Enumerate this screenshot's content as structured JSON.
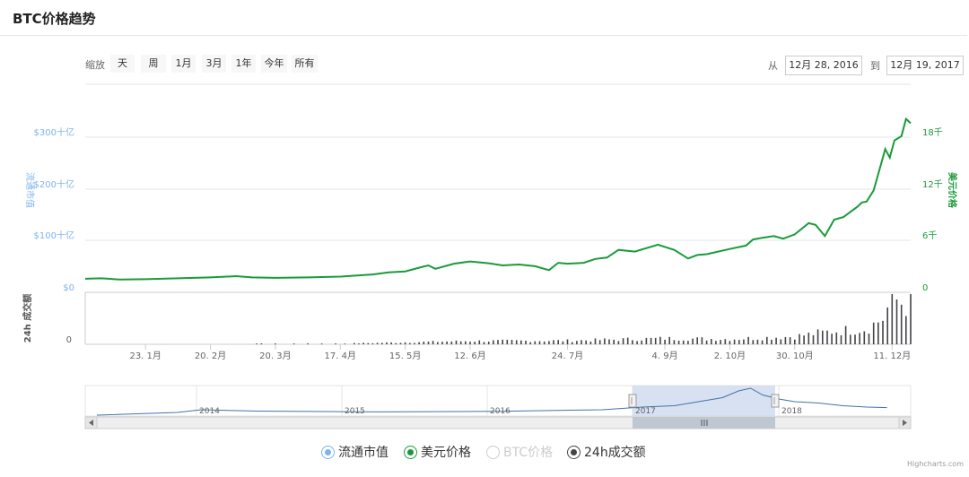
{
  "header": {
    "title": "BTC价格趋势"
  },
  "range_selector": {
    "zoom_label": "缩放",
    "buttons": [
      "天",
      "周",
      "1月",
      "3月",
      "1年",
      "今年",
      "所有"
    ],
    "from_label": "从",
    "from_value": "12月 28, 2016",
    "to_label": "到",
    "to_value": "12月 19, 2017"
  },
  "colors": {
    "market_cap": "#7cb5ec",
    "price": "#1a9b3a",
    "volume": "#434348",
    "navigator_fill": "#c6d4ec"
  },
  "legend": [
    {
      "label": "流通市值",
      "color": "#7cb5ec",
      "enabled": true
    },
    {
      "label": "美元价格",
      "color": "#1a9b3a",
      "enabled": true
    },
    {
      "label": "BTC价格",
      "color": "#cccccc",
      "enabled": false
    },
    {
      "label": "24h成交额",
      "color": "#434348",
      "enabled": true
    }
  ],
  "credit": "Highcharts.com",
  "chart_data": {
    "type": "line",
    "x_ticks": [
      "23. 1月",
      "20. 2月",
      "20. 3月",
      "17. 4月",
      "15. 5月",
      "12. 6月",
      "24. 7月",
      "4. 9月",
      "2. 10月",
      "30. 10月",
      "11. 12月"
    ],
    "left_axis": {
      "label": "流通市值",
      "ticks": [
        "$0",
        "$100十亿",
        "$200十亿",
        "$300十亿"
      ],
      "range": [
        0,
        300
      ]
    },
    "right_axis": {
      "label": "美元价格",
      "ticks": [
        "0",
        "6千",
        "12千",
        "18千"
      ],
      "range": [
        0,
        18000
      ]
    },
    "volume_axis": {
      "label": "24h 成交额",
      "ticks": [
        "0"
      ]
    },
    "series": [
      {
        "name": "美元价格",
        "axis": "right",
        "x": [
          "2016-12-28",
          "2017-01-04",
          "2017-01-12",
          "2017-01-23",
          "2017-02-06",
          "2017-02-20",
          "2017-03-03",
          "2017-03-10",
          "2017-03-20",
          "2017-04-03",
          "2017-04-17",
          "2017-05-01",
          "2017-05-08",
          "2017-05-15",
          "2017-05-22",
          "2017-05-25",
          "2017-05-28",
          "2017-06-05",
          "2017-06-12",
          "2017-06-20",
          "2017-06-26",
          "2017-07-03",
          "2017-07-10",
          "2017-07-16",
          "2017-07-20",
          "2017-07-24",
          "2017-07-31",
          "2017-08-05",
          "2017-08-10",
          "2017-08-15",
          "2017-08-22",
          "2017-09-01",
          "2017-09-08",
          "2017-09-14",
          "2017-09-18",
          "2017-09-22",
          "2017-10-02",
          "2017-10-09",
          "2017-10-12",
          "2017-10-16",
          "2017-10-21",
          "2017-10-25",
          "2017-10-30",
          "2017-11-05",
          "2017-11-08",
          "2017-11-12",
          "2017-11-16",
          "2017-11-20",
          "2017-11-26",
          "2017-11-28",
          "2017-11-30",
          "2017-12-03",
          "2017-12-07",
          "2017-12-08",
          "2017-12-10",
          "2017-12-12",
          "2017-12-15",
          "2017-12-17",
          "2017-12-19"
        ],
        "values": [
          950,
          1000,
          850,
          900,
          1000,
          1100,
          1250,
          1100,
          1050,
          1100,
          1200,
          1450,
          1700,
          1800,
          2300,
          2500,
          2100,
          2700,
          2950,
          2750,
          2500,
          2600,
          2400,
          1950,
          2800,
          2700,
          2800,
          3250,
          3400,
          4300,
          4100,
          4900,
          4300,
          3300,
          3700,
          3800,
          4400,
          4800,
          5500,
          5700,
          5900,
          5600,
          6100,
          7400,
          7200,
          5900,
          7800,
          8100,
          9300,
          9800,
          9900,
          11200,
          15000,
          16000,
          15000,
          17000,
          17500,
          19500,
          19000
        ]
      },
      {
        "name": "流通市值",
        "axis": "left",
        "x": [
          "2016-12-28",
          "2017-12-19"
        ],
        "values": [
          15,
          315
        ]
      },
      {
        "name": "24h成交额",
        "axis": "volume",
        "type": "bar",
        "x": [
          "2016-12-28",
          "2017-01-23",
          "2017-02-20",
          "2017-03-20",
          "2017-04-17",
          "2017-05-15",
          "2017-06-12",
          "2017-07-24",
          "2017-09-04",
          "2017-10-02",
          "2017-10-30",
          "2017-11-15",
          "2017-11-30",
          "2017-12-07",
          "2017-12-11",
          "2017-12-19"
        ],
        "values": [
          0.3,
          0.3,
          0.4,
          0.5,
          0.6,
          1.5,
          2.5,
          2.8,
          4.5,
          4.0,
          6.0,
          10.0,
          12.0,
          20.0,
          35.0,
          30.0
        ]
      }
    ],
    "navigator": {
      "x_ticks": [
        "2014",
        "2015",
        "2016",
        "2017",
        "2018"
      ]
    }
  }
}
